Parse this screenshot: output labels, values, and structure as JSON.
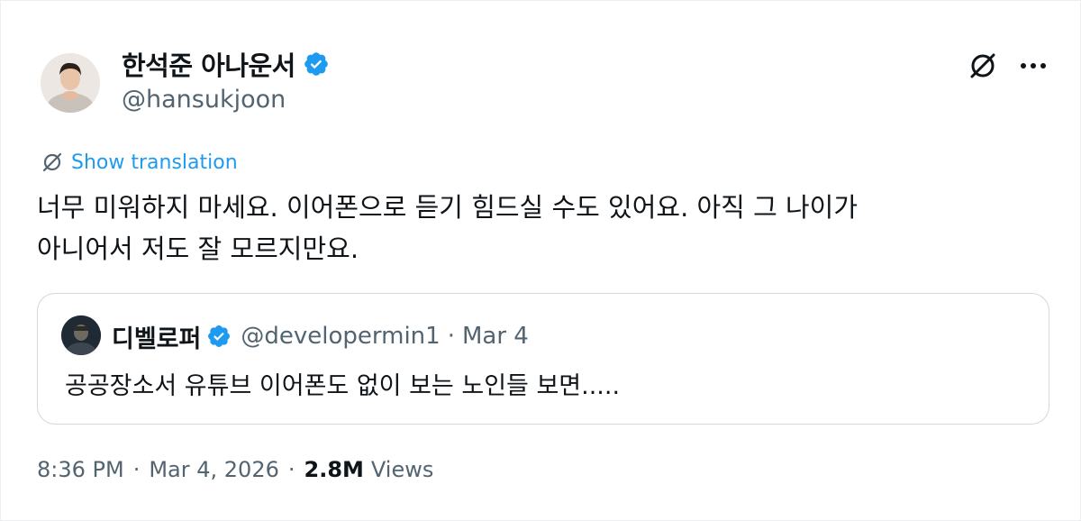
{
  "author": {
    "display_name": "한석준 아나운서",
    "handle": "@hansukjoon",
    "verified": true,
    "avatar_icon": "person-avatar"
  },
  "actions": {
    "grok_icon": "grok-icon",
    "more_icon": "more-dots-icon"
  },
  "translation": {
    "icon": "grok-icon",
    "label": "Show translation"
  },
  "tweet": {
    "text": "너무 미워하지 마세요. 이어폰으로 듣기 힘드실 수도 있어요. 아직 그 나이가\n아니어서 저도 잘 모르지만요."
  },
  "quote": {
    "display_name": "디벨로퍼",
    "handle": "@developermin1",
    "separator": "·",
    "date": "Mar 4",
    "verified": true,
    "text": "공공장소서 유튜브 이어폰도 없이 보는 노인들 보면....."
  },
  "meta": {
    "time": "8:36 PM",
    "separator": "·",
    "date": "Mar 4, 2026",
    "separator2": "·",
    "views_count": "2.8M",
    "views_label": "Views"
  },
  "colors": {
    "accent": "#1d9bf0",
    "text": "#0f1419",
    "secondary": "#536471",
    "border": "#cfd9de"
  }
}
